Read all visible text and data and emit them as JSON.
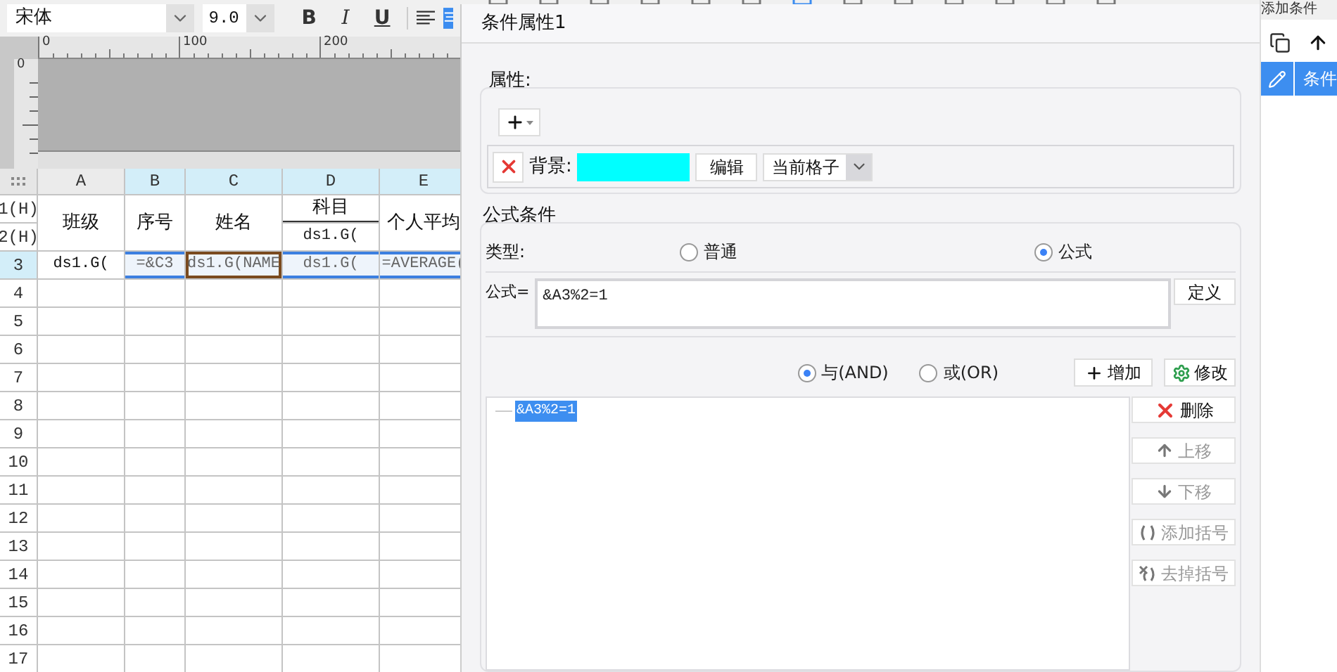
{
  "toolbar": {
    "font": "宋体",
    "size": "9.0",
    "styles": [
      {
        "kind": "bold",
        "label": "B"
      },
      {
        "kind": "italic",
        "label": "I"
      },
      {
        "kind": "underline",
        "label": "U"
      }
    ]
  },
  "ruler": {
    "ticks": [
      "0",
      "100",
      "200"
    ],
    "vertical_tick": "0"
  },
  "sheet": {
    "columns": [
      {
        "label": "A",
        "selected": false
      },
      {
        "label": "B",
        "selected": true
      },
      {
        "label": "C",
        "selected": true
      },
      {
        "label": "D",
        "selected": true
      },
      {
        "label": "E",
        "selected": true
      }
    ],
    "rows": [
      {
        "label": "1(H)",
        "selected": false
      },
      {
        "label": "2(H)",
        "selected": false
      },
      {
        "label": "3",
        "selected": true
      },
      {
        "label": "4",
        "selected": false
      },
      {
        "label": "5",
        "selected": false
      },
      {
        "label": "6",
        "selected": false
      },
      {
        "label": "7",
        "selected": false
      },
      {
        "label": "8",
        "selected": false
      },
      {
        "label": "9",
        "selected": false
      },
      {
        "label": "10",
        "selected": false
      },
      {
        "label": "11",
        "selected": false
      },
      {
        "label": "12",
        "selected": false
      },
      {
        "label": "13",
        "selected": false
      },
      {
        "label": "14",
        "selected": false
      },
      {
        "label": "15",
        "selected": false
      },
      {
        "label": "16",
        "selected": false
      },
      {
        "label": "17",
        "selected": false
      }
    ],
    "header": [
      {
        "kind": "merged",
        "text": "班级"
      },
      {
        "kind": "merged",
        "text": "序号"
      },
      {
        "kind": "merged",
        "text": "姓名"
      },
      {
        "kind": "split",
        "text": "科目",
        "lower": "ds1.G("
      },
      {
        "kind": "merged",
        "text": "个人平均"
      }
    ],
    "data_row": [
      {
        "text": "ds1.G(",
        "selected": false,
        "active": false
      },
      {
        "text": "=&C3",
        "selected": true,
        "active": false
      },
      {
        "text": "ds1.G(NAME",
        "selected": true,
        "active": true
      },
      {
        "text": "ds1.G(",
        "selected": true,
        "active": false
      },
      {
        "text": "=AVERAGE(",
        "selected": true,
        "active": false
      }
    ]
  },
  "dialog": {
    "title": "条件属性1",
    "attributes": {
      "legend": "属性:",
      "background_label": "背景:",
      "color": "#00ffff",
      "edit_button": "编辑",
      "scope": "当前格子"
    },
    "formula_condition": {
      "legend": "公式条件",
      "type_label": "类型:",
      "types": [
        {
          "label": "普通",
          "selected": false
        },
        {
          "label": "公式",
          "selected": true
        }
      ],
      "formula_label": "公式=",
      "formula_value": "&A3%2=1",
      "define_button": "定义",
      "logic": [
        {
          "label": "与(AND)",
          "selected": true
        },
        {
          "label": "或(OR)",
          "selected": false
        }
      ],
      "add_button": "增加",
      "modify_button": "修改",
      "conditions": [
        {
          "text": "&A3%2=1",
          "selected": true
        }
      ],
      "side_buttons": [
        {
          "kind": "delete",
          "label": "删除",
          "disabled": false
        },
        {
          "kind": "up",
          "label": "上移",
          "disabled": true
        },
        {
          "kind": "down",
          "label": "下移",
          "disabled": true
        },
        {
          "kind": "add_brackets",
          "label": "添加括号",
          "disabled": true
        },
        {
          "kind": "remove_brackets",
          "label": "去掉括号",
          "disabled": true
        }
      ]
    }
  },
  "side_panel": {
    "title": "添加条件",
    "items": [
      {
        "label": "条件",
        "selected": true
      }
    ]
  }
}
